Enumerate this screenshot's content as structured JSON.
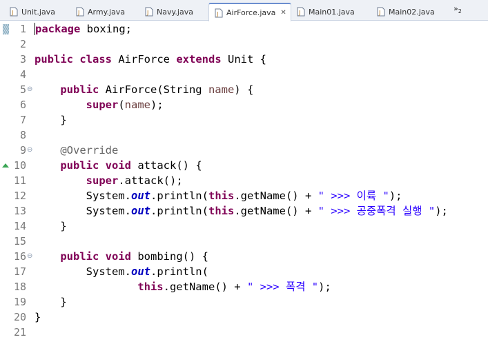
{
  "tabs": [
    {
      "label": "Unit.java",
      "active": false
    },
    {
      "label": "Army.java",
      "active": false
    },
    {
      "label": "Navy.java",
      "active": false
    },
    {
      "label": "AirForce.java",
      "active": true
    },
    {
      "label": "Main01.java",
      "active": false
    },
    {
      "label": "Main02.java",
      "active": false
    }
  ],
  "overflow": {
    "symbol": "»",
    "count": "2"
  },
  "close_glyph": "✕",
  "editor": {
    "lines": [
      {
        "n": "1",
        "fold": "",
        "tokens": [
          [
            "kw",
            "package"
          ],
          [
            "t",
            " boxing;"
          ]
        ]
      },
      {
        "n": "2",
        "fold": "",
        "tokens": []
      },
      {
        "n": "3",
        "fold": "",
        "tokens": [
          [
            "kw",
            "public"
          ],
          [
            "t",
            " "
          ],
          [
            "kw",
            "class"
          ],
          [
            "t",
            " AirForce "
          ],
          [
            "kw",
            "extends"
          ],
          [
            "t",
            " Unit {"
          ]
        ]
      },
      {
        "n": "4",
        "fold": "",
        "tokens": []
      },
      {
        "n": "5",
        "fold": "⊖",
        "tokens": [
          [
            "t",
            "    "
          ],
          [
            "kw",
            "public"
          ],
          [
            "t",
            " AirForce(String "
          ],
          [
            "par",
            "name"
          ],
          [
            "t",
            ") {"
          ]
        ]
      },
      {
        "n": "6",
        "fold": "",
        "tokens": [
          [
            "t",
            "        "
          ],
          [
            "kw",
            "super"
          ],
          [
            "t",
            "("
          ],
          [
            "par",
            "name"
          ],
          [
            "t",
            ");"
          ]
        ]
      },
      {
        "n": "7",
        "fold": "",
        "tokens": [
          [
            "t",
            "    }"
          ]
        ]
      },
      {
        "n": "8",
        "fold": "",
        "tokens": []
      },
      {
        "n": "9",
        "fold": "⊖",
        "tokens": [
          [
            "t",
            "    "
          ],
          [
            "ann",
            "@Override"
          ]
        ]
      },
      {
        "n": "10",
        "fold": "",
        "tokens": [
          [
            "t",
            "    "
          ],
          [
            "kw",
            "public"
          ],
          [
            "t",
            " "
          ],
          [
            "kw",
            "void"
          ],
          [
            "t",
            " attack() {"
          ]
        ]
      },
      {
        "n": "11",
        "fold": "",
        "tokens": [
          [
            "t",
            "        "
          ],
          [
            "kw",
            "super"
          ],
          [
            "t",
            ".attack();"
          ]
        ]
      },
      {
        "n": "12",
        "fold": "",
        "tokens": [
          [
            "t",
            "        System."
          ],
          [
            "fld",
            "out"
          ],
          [
            "t",
            ".println("
          ],
          [
            "kw",
            "this"
          ],
          [
            "t",
            ".getName() + "
          ],
          [
            "str",
            "\" >>> 이륙 \""
          ],
          [
            "t",
            ");"
          ]
        ]
      },
      {
        "n": "13",
        "fold": "",
        "tokens": [
          [
            "t",
            "        System."
          ],
          [
            "fld",
            "out"
          ],
          [
            "t",
            ".println("
          ],
          [
            "kw",
            "this"
          ],
          [
            "t",
            ".getName() + "
          ],
          [
            "str",
            "\" >>> 공중폭격 실행 \""
          ],
          [
            "t",
            ");"
          ]
        ]
      },
      {
        "n": "14",
        "fold": "",
        "tokens": [
          [
            "t",
            "    }"
          ]
        ]
      },
      {
        "n": "15",
        "fold": "",
        "tokens": []
      },
      {
        "n": "16",
        "fold": "⊖",
        "tokens": [
          [
            "t",
            "    "
          ],
          [
            "kw",
            "public"
          ],
          [
            "t",
            " "
          ],
          [
            "kw",
            "void"
          ],
          [
            "t",
            " bombing() {"
          ]
        ]
      },
      {
        "n": "17",
        "fold": "",
        "tokens": [
          [
            "t",
            "        System."
          ],
          [
            "fld",
            "out"
          ],
          [
            "t",
            ".println("
          ]
        ]
      },
      {
        "n": "18",
        "fold": "",
        "tokens": [
          [
            "t",
            "                "
          ],
          [
            "kw",
            "this"
          ],
          [
            "t",
            ".getName() + "
          ],
          [
            "str",
            "\" >>> 폭격 \""
          ],
          [
            "t",
            ");"
          ]
        ]
      },
      {
        "n": "19",
        "fold": "",
        "tokens": [
          [
            "t",
            "    }"
          ]
        ]
      },
      {
        "n": "20",
        "fold": "",
        "tokens": [
          [
            "t",
            "}"
          ]
        ]
      },
      {
        "n": "21",
        "fold": "",
        "tokens": []
      }
    ]
  },
  "colors": {
    "keyword": "#7f0055",
    "string": "#2a00ff",
    "field": "#0000c0",
    "annotation": "#646464",
    "parameter": "#6a3e3e",
    "line_number": "#787878",
    "override_marker": "#3aa655",
    "active_tab_accent": "#6b8ecf"
  }
}
